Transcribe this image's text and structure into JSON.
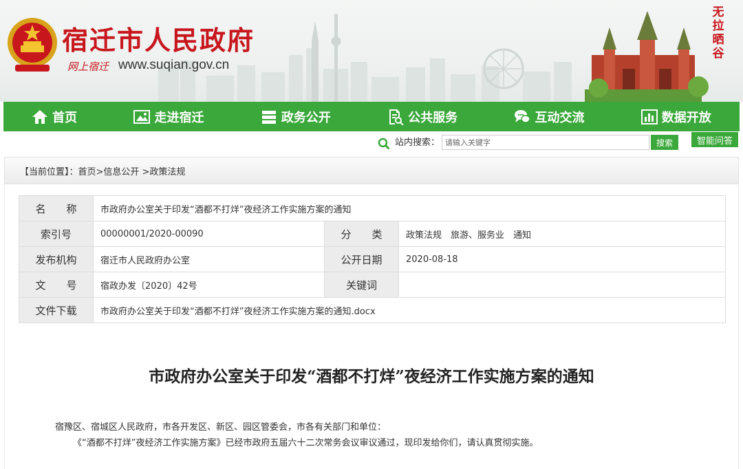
{
  "header": {
    "site_name": "宿迁市人民政府",
    "slogan": "网上宿迁",
    "url": "www.suqian.gov.cn",
    "calligraphy": "无拉晒谷"
  },
  "nav": [
    {
      "label": "首页",
      "icon": "home-icon"
    },
    {
      "label": "走进宿迁",
      "icon": "image-icon"
    },
    {
      "label": "政务公开",
      "icon": "stack-icon"
    },
    {
      "label": "公共服务",
      "icon": "document-search-icon"
    },
    {
      "label": "互动交流",
      "icon": "chat-icon"
    },
    {
      "label": "数据开放",
      "icon": "bar-chart-icon"
    }
  ],
  "search": {
    "label": "站内搜索：",
    "placeholder": "请输入关键字",
    "button": "搜索",
    "qa_button": "智能问答"
  },
  "breadcrumb": {
    "prefix": "【当前位置】：",
    "path": "首页>信息公开 >政策法规"
  },
  "meta": {
    "name_label": "名　　称",
    "name_value": "市政府办公室关于印发“酒都不打烊”夜经济工作实施方案的通知",
    "index_label": "索引号",
    "index_value": "00000001/2020-00090",
    "category_label": "分　　类",
    "category_value": "政策法规　旅游、服务业　通知",
    "publisher_label": "发布机构",
    "publisher_value": "宿迁市人民政府办公室",
    "date_label": "公开日期",
    "date_value": "2020-08-18",
    "docno_label": "文　　号",
    "docno_value": "宿政办发〔2020〕42号",
    "keyword_label": "关键词",
    "keyword_value": "",
    "download_label": "文件下载",
    "download_value": "市政府办公室关于印发“酒都不打烊”夜经济工作实施方案的通知.docx"
  },
  "article": {
    "title": "市政府办公室关于印发“酒都不打烊”夜经济工作实施方案的通知",
    "salutation": "宿豫区、宿城区人民政府，市各开发区、新区、园区管委会，市各有关部门和单位：",
    "para1": "《“酒都不打烊”夜经济工作实施方案》已经市政府五届六十二次常务会议审议通过，现印发给你们，请认真贯彻实施。"
  },
  "colors": {
    "nav_green": "#3aa83a",
    "brand_red": "#c8161d"
  }
}
